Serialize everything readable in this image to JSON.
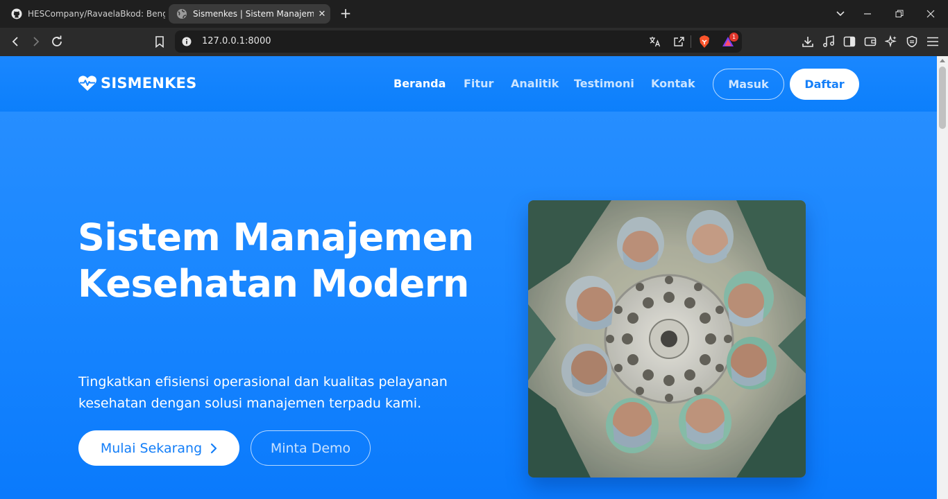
{
  "browser": {
    "tabs": [
      {
        "title": "HESCompany/RavaelaBkod: Bengkulu Kodin",
        "favicon": "github-icon",
        "active": false
      },
      {
        "title": "Sismenkes | Sistem Manajemen Kesehatan",
        "favicon": "globe-icon",
        "active": true
      }
    ],
    "new_tab_label": "+",
    "close_label": "✕",
    "url": "127.0.0.1:8000",
    "shields_badge": "1"
  },
  "site": {
    "brand": "SISMENKES",
    "nav": [
      {
        "label": "Beranda",
        "active": true
      },
      {
        "label": "Fitur",
        "active": false
      },
      {
        "label": "Analitik",
        "active": false
      },
      {
        "label": "Testimoni",
        "active": false
      },
      {
        "label": "Kontak",
        "active": false
      }
    ],
    "login_label": "Masuk",
    "register_label": "Daftar"
  },
  "hero": {
    "title": "Sistem Manajemen Kesehatan Modern",
    "subtitle": "Tingkatkan efisiensi operasional dan kualitas pelayanan kesehatan dengan solusi manajemen terpadu kami.",
    "primary_cta": "Mulai Sekarang",
    "secondary_cta": "Minta Demo",
    "image_icon": "surgeons-circle-photo"
  },
  "colors": {
    "brand_blue": "#1a87ff",
    "white": "#ffffff",
    "chrome_dark": "#1f1f1f"
  }
}
